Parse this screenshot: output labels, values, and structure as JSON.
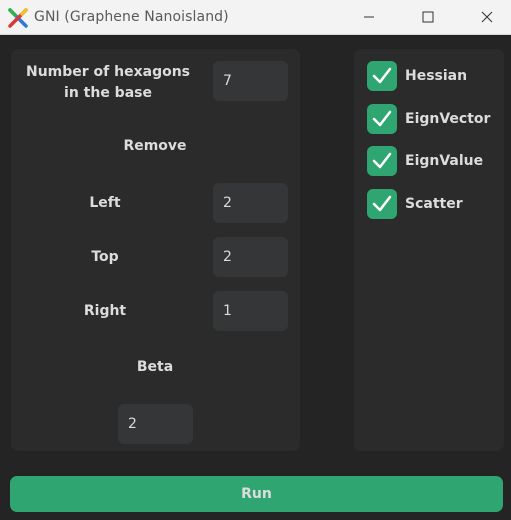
{
  "window": {
    "title": "GNI (Graphene Nanoisland)"
  },
  "params": {
    "hexagons_label": "Number  of hexagons\nin the base",
    "hexagons_value": "7",
    "remove_label": "Remove",
    "left_label": "Left",
    "left_value": "2",
    "top_label": "Top",
    "top_value": "2",
    "right_label": "Right",
    "right_value": "1",
    "beta_label": "Beta",
    "beta_value": "2"
  },
  "options": [
    {
      "label": "Hessian",
      "checked": true
    },
    {
      "label": "EignVector",
      "checked": true
    },
    {
      "label": "EignValue",
      "checked": true
    },
    {
      "label": "Scatter",
      "checked": true
    }
  ],
  "run_label": "Run",
  "colors": {
    "accent": "#2fa572",
    "panel": "#2b2b2b",
    "background": "#242424",
    "entry": "#343638"
  }
}
